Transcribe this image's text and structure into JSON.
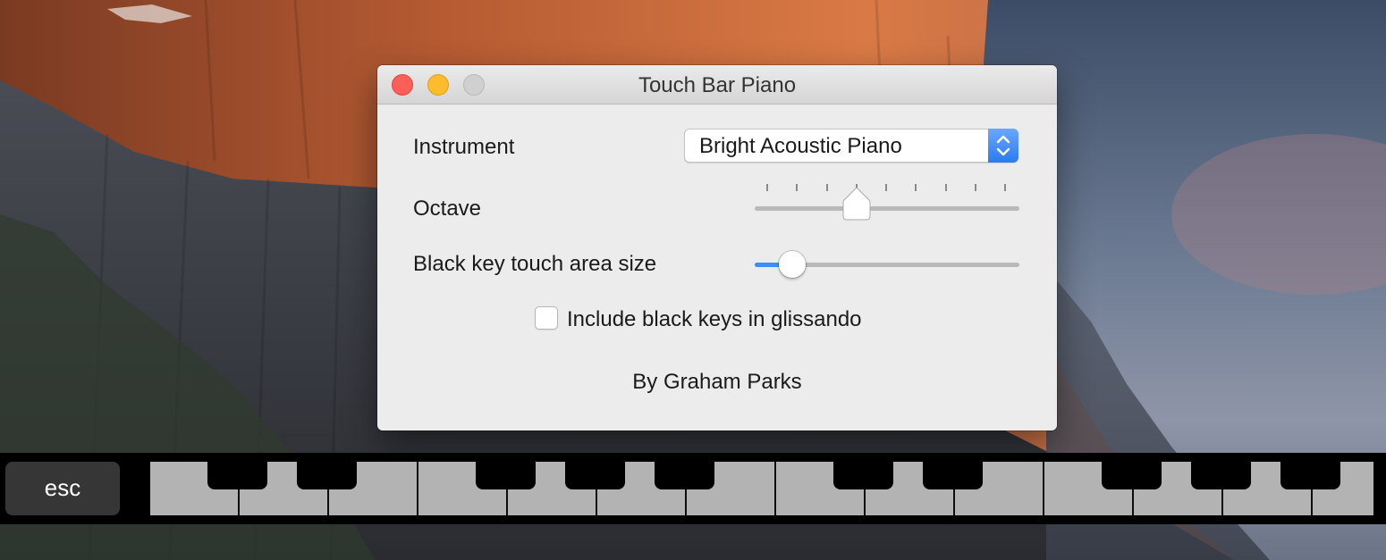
{
  "window": {
    "title": "Touch Bar Piano"
  },
  "instrument": {
    "label": "Instrument",
    "selected": "Bright Acoustic Piano"
  },
  "octave": {
    "label": "Octave",
    "tick_count": 9,
    "value_index": 3
  },
  "black_key_area": {
    "label": "Black key touch area size",
    "value_fraction": 0.14
  },
  "glissando": {
    "label": "Include black keys in glissando",
    "checked": false
  },
  "credit": "By Graham Parks",
  "touchbar": {
    "esc_label": "esc",
    "white_key_count": 14,
    "black_key_count": 10
  },
  "colors": {
    "accent": "#3d8ff7",
    "close": "#fc5f57",
    "minimize": "#fdbb2e",
    "zoom_disabled": "#d0d0d0"
  }
}
